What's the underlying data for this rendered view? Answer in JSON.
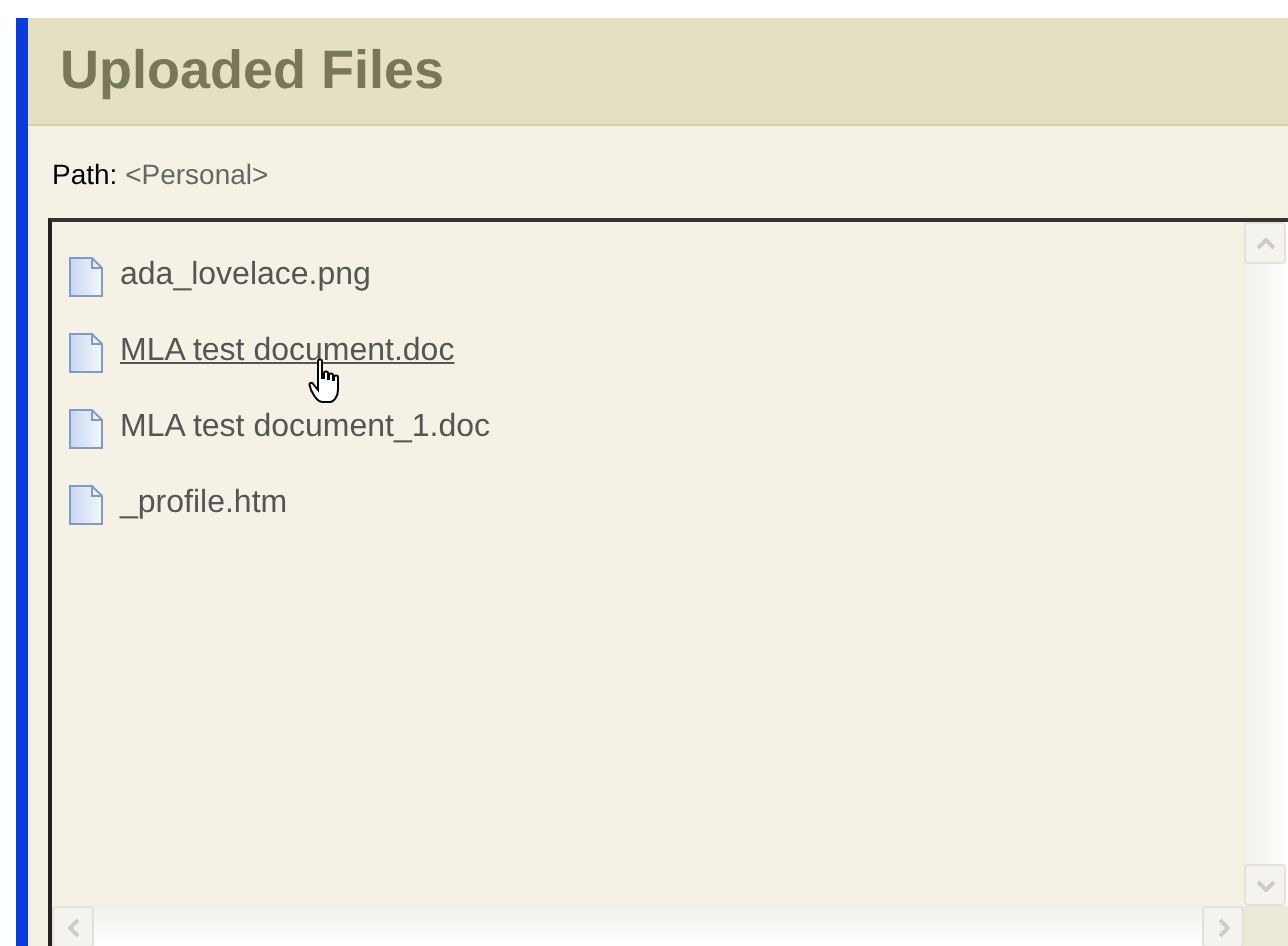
{
  "panel": {
    "title": "Uploaded Files",
    "path_label": "Path:",
    "path_value": "<Personal>"
  },
  "files": [
    {
      "name": "ada_lovelace.png",
      "hovered": false
    },
    {
      "name": "MLA test document.doc",
      "hovered": true
    },
    {
      "name": "MLA test document_1.doc",
      "hovered": false
    },
    {
      "name": "_profile.htm",
      "hovered": false
    }
  ]
}
